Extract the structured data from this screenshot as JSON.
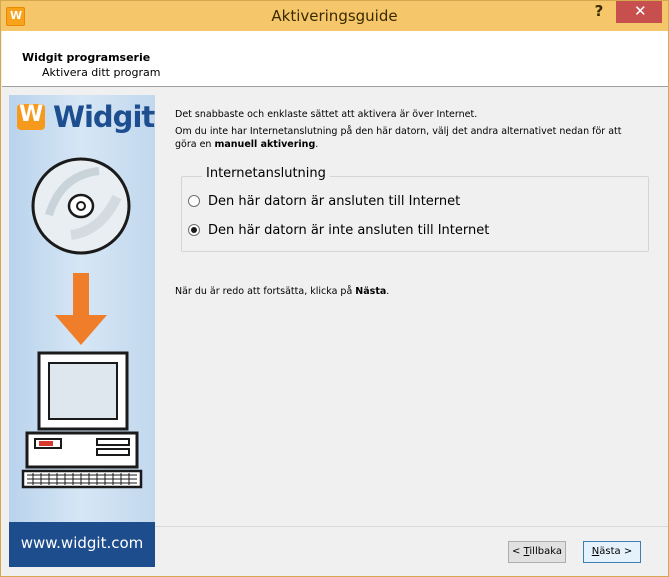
{
  "window": {
    "title": "Aktiveringsguide",
    "help_label": "?",
    "close_label": "✕",
    "app_icon_label": "W"
  },
  "header": {
    "title": "Widgit programserie",
    "subtitle": "Aktivera ditt program"
  },
  "side": {
    "logo_text": "Widgit",
    "logo_mark": "W",
    "url": "www.widgit.com"
  },
  "content": {
    "intro": "Det snabbaste och enklaste sättet att aktivera är över Internet.",
    "info_prefix": "Om du inte har Internetanslutning på den här datorn, välj det andra alternativet nedan för att göra en ",
    "info_bold": "manuell aktivering",
    "info_suffix": ".",
    "group_label": "Internetanslutning",
    "options": [
      {
        "label": "Den här datorn är ansluten till Internet",
        "selected": false
      },
      {
        "label": "Den här datorn är inte ansluten till Internet",
        "selected": true
      }
    ],
    "next_hint_prefix": "När du är redo att fortsätta, klicka på ",
    "next_hint_bold": "Nästa",
    "next_hint_suffix": "."
  },
  "buttons": {
    "back_prefix": "< ",
    "back_mnemonic": "T",
    "back_rest": "illbaka",
    "next_mnemonic": "N",
    "next_rest": "ästa >"
  },
  "colors": {
    "titlebar": "#f5c76a",
    "close": "#c7504f",
    "brand_blue": "#1e4d8d",
    "brand_orange": "#f59a1c"
  }
}
